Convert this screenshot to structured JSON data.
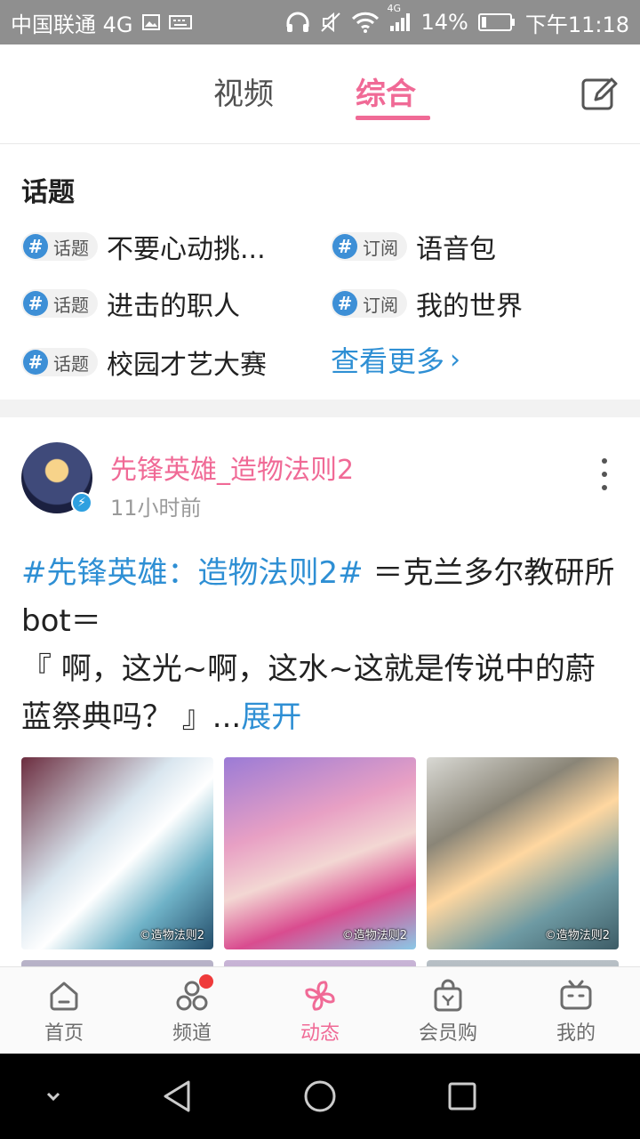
{
  "status_bar": {
    "carrier": "中国联通 4G",
    "network_badge": "4G",
    "battery": "14%",
    "time": "下午11:18"
  },
  "tabs": [
    {
      "label": "视频",
      "active": false
    },
    {
      "label": "综合",
      "active": true
    }
  ],
  "topics": {
    "title": "话题",
    "items": [
      {
        "tag": "话题",
        "name": "不要心动挑..."
      },
      {
        "tag": "订阅",
        "name": "语音包"
      },
      {
        "tag": "话题",
        "name": "进击的职人"
      },
      {
        "tag": "订阅",
        "name": "我的世界"
      },
      {
        "tag": "话题",
        "name": "校园才艺大赛"
      }
    ],
    "more_label": "查看更多",
    "hash_symbol": "#"
  },
  "post": {
    "author": "先锋英雄_造物法则2",
    "time": "11小时前",
    "hashtag": "#先锋英雄：造物法则2#",
    "text_1": " ＝克兰多尔教研所bot＝",
    "text_2": "『 啊，这光~啊，这水~这就是传说中的蔚蓝祭典吗？ 』...",
    "expand_label": "展开",
    "watermark": "©造物法则2"
  },
  "bottom_nav": [
    {
      "label": "首页",
      "icon": "home-icon",
      "active": false
    },
    {
      "label": "频道",
      "icon": "channel-icon",
      "active": false,
      "badge": true
    },
    {
      "label": "动态",
      "icon": "pinwheel-icon",
      "active": true
    },
    {
      "label": "会员购",
      "icon": "shopping-bag-icon",
      "active": false
    },
    {
      "label": "我的",
      "icon": "tv-icon",
      "active": false
    }
  ],
  "colors": {
    "accent": "#f06a96",
    "link": "#2e8fd4",
    "status_bar": "#8f8f8f"
  }
}
